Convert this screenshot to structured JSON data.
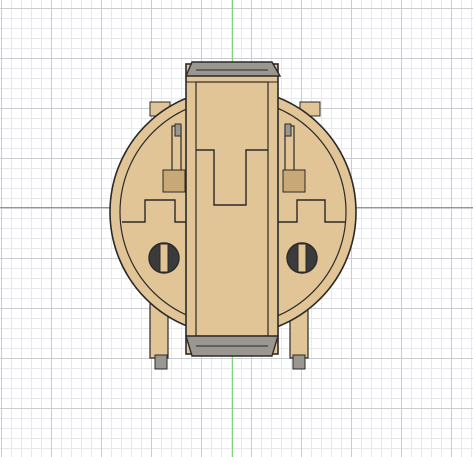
{
  "viewport": {
    "background": "#ffffff",
    "grid_major_color": "#c9cdd2",
    "grid_minor_color": "#e6e8eb",
    "axis_green": "#7fd27f",
    "axis_red": "#e8707a"
  },
  "model": {
    "body_color": "#e2c597",
    "body_dark": "#c9a877",
    "shadow_color": "#8a8068",
    "outline_color": "#2a2a2a",
    "cap_color": "#9a9690",
    "screw_color": "#3b3b3b"
  }
}
